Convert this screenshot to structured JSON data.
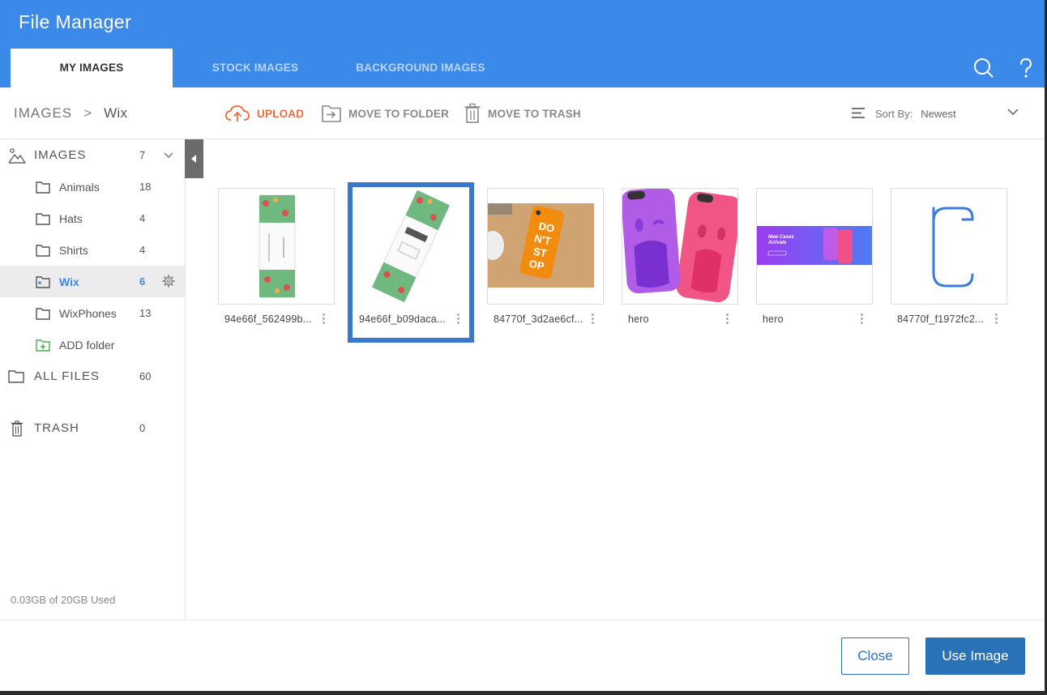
{
  "app": {
    "title": "File Manager"
  },
  "tabs": [
    {
      "label": "MY IMAGES",
      "active": true
    },
    {
      "label": "STOCK IMAGES",
      "active": false
    },
    {
      "label": "BACKGROUND IMAGES",
      "active": false
    }
  ],
  "header_icons": [
    "search-icon",
    "help-icon"
  ],
  "breadcrumb": {
    "root": "IMAGES",
    "separator": ">",
    "current": "Wix"
  },
  "toolbar": {
    "upload": "UPLOAD",
    "move_to_folder": "MOVE TO FOLDER",
    "move_to_trash": "MOVE TO TRASH",
    "sort_label": "Sort By:",
    "sort_value": "Newest"
  },
  "sidebar": {
    "images": {
      "label": "IMAGES",
      "count": "7"
    },
    "folders": [
      {
        "label": "Animals",
        "count": "18"
      },
      {
        "label": "Hats",
        "count": "4"
      },
      {
        "label": "Shirts",
        "count": "4"
      },
      {
        "label": "Wix",
        "count": "6",
        "selected": true
      },
      {
        "label": "WixPhones",
        "count": "13"
      }
    ],
    "add_folder": "ADD folder",
    "all_files": {
      "label": "ALL FILES",
      "count": "60"
    },
    "trash": {
      "label": "TRASH",
      "count": "0"
    },
    "storage": "0.03GB of 20GB Used"
  },
  "files": [
    {
      "name": "94e66f_562499b...",
      "selected": false
    },
    {
      "name": "94e66f_b09daca...",
      "selected": true
    },
    {
      "name": "84770f_3d2ae6cf...",
      "selected": false
    },
    {
      "name": "hero",
      "selected": false
    },
    {
      "name": "hero",
      "selected": false
    },
    {
      "name": "84770f_f1972fc2...",
      "selected": false
    }
  ],
  "footer": {
    "close": "Close",
    "use_image": "Use Image"
  },
  "colors": {
    "header": "#3b89e8",
    "accent": "#3a78cc",
    "upload": "#ee6a3c",
    "primary_button": "#2a72b8"
  }
}
